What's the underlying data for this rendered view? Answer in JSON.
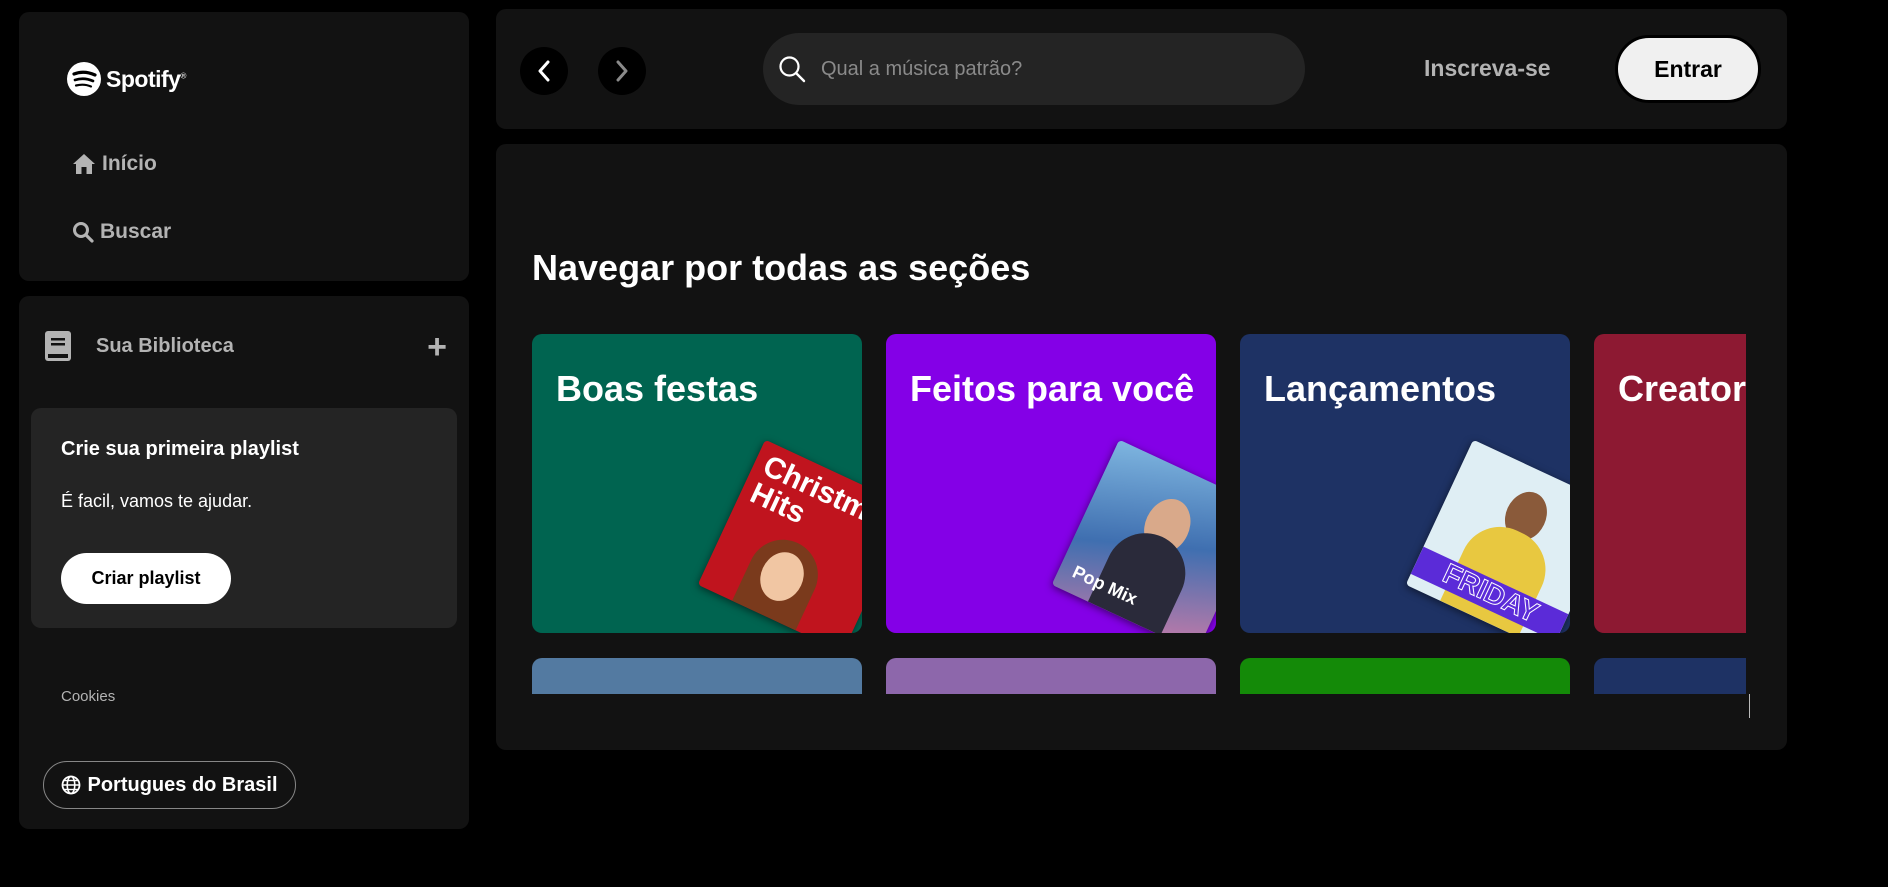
{
  "brand": {
    "name": "Spotify",
    "mark": "®"
  },
  "nav": {
    "home_label": "Início",
    "search_label": "Buscar"
  },
  "library": {
    "title": "Sua Biblioteca",
    "add_symbol": "+",
    "create_card": {
      "title": "Crie sua primeira playlist",
      "subtitle": "É facil, vamos te ajudar.",
      "button_label": "Criar playlist"
    },
    "cookies_label": "Cookies",
    "language_label": "Portugues do Brasil"
  },
  "header": {
    "search_placeholder": "Qual a música patrão?",
    "signup_label": "Inscreva-se",
    "login_label": "Entrar"
  },
  "browse": {
    "title": "Navegar por todas as seções",
    "cards": [
      {
        "title": "Boas festas",
        "color": "#006450",
        "art_text": "Christmas Hits"
      },
      {
        "title": "Feitos para você",
        "color": "#8400e7",
        "art_text": "Pop Mix"
      },
      {
        "title": "Lançamentos",
        "color": "#1e3264",
        "art_text": "FRIDAY"
      },
      {
        "title": "Creators",
        "color": "#8d1932"
      }
    ],
    "row2_colors": [
      "#537aa1",
      "#8d67ab",
      "#148a08",
      "#1e3264"
    ]
  }
}
